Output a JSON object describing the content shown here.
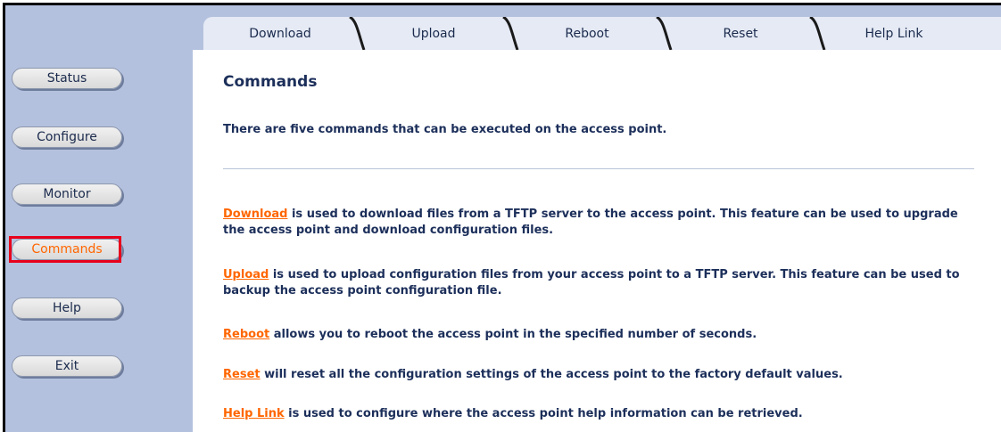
{
  "tabs": [
    {
      "label": "Download"
    },
    {
      "label": "Upload"
    },
    {
      "label": "Reboot"
    },
    {
      "label": "Reset"
    },
    {
      "label": "Help Link"
    }
  ],
  "sidebar": {
    "items": [
      {
        "label": "Status"
      },
      {
        "label": "Configure"
      },
      {
        "label": "Monitor"
      },
      {
        "label": "Commands"
      },
      {
        "label": "Help"
      },
      {
        "label": "Exit"
      }
    ],
    "active": "Commands"
  },
  "main": {
    "title": "Commands",
    "intro": "There are five commands that can be executed on the access point.",
    "commands": [
      {
        "link": "Download",
        "text": " is used to download files from a TFTP server to the access point. This feature can be used to upgrade the access point and download configuration files."
      },
      {
        "link": "Upload",
        "text": " is used to upload configuration files from your access point to a TFTP server. This feature can be used to backup the access point configuration file."
      },
      {
        "link": "Reboot",
        "text": " allows you to reboot the access point in the specified number of seconds."
      },
      {
        "link": "Reset",
        "text": " will reset all the configuration settings of the access point to the factory default values."
      },
      {
        "link": "Help Link",
        "text": " is used to configure where the access point help information can be retrieved."
      }
    ]
  },
  "colors": {
    "accent": "#ff6600",
    "sidebar_bg": "#b4c1de",
    "text": "#1c2f5a",
    "highlight": "#e8001c"
  }
}
